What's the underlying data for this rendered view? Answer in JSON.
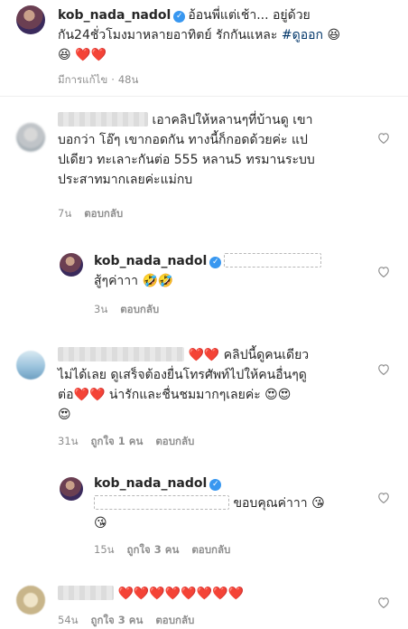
{
  "post": {
    "username": "kob_nada_nadol",
    "verified_icon": "verified-badge-icon",
    "caption_line1": "อ้อนพี่แต่เช้า... อยู่ด้วย",
    "caption_line2_a": "กัน24ชั่วโมงมาหลายอาทิตย์ รักกันแหละ",
    "hashtag": "#ดูออก",
    "emoji_grin": "😆",
    "emoji_heart": "❤️",
    "meta_edited": "มีการแก้ไข",
    "meta_dot": "·",
    "meta_time": "48น"
  },
  "comments": [
    {
      "line1": "เอาคลิปให้หลานๆที่บ้านดู เขา",
      "line2": "บอกว่า โอ๊ๆ เขากอดกัน ทางนี้ก็กอดด้วยค่ะ แป",
      "line3": "ปเดียว ทะเลาะกันต่อ 555 หลาน5 ทรมานระบบ",
      "line4": "ประสาทมากเลยค่ะแม่กบ",
      "time": "7น",
      "reply_label": "ตอบกลับ"
    },
    {
      "username": "kob_nada_nadol",
      "text": "สู้ๆค่าาา",
      "emoji": "🤣🤣",
      "time": "3น",
      "reply_label": "ตอบกลับ"
    },
    {
      "line1_text": "คลิปนี้ดูคนเดียว",
      "line2": "ไม่ได้เลย ดูเสร็จต้องยื่นโทรศัพท์ไปให้คนอื่นๆดู",
      "line3_a": "ต่อ",
      "line3_b": "น่ารักและชื่นชมมากๆเลยค่ะ",
      "emoji_eyes": "😍",
      "time": "31น",
      "likes": "ถูกใจ 1 คน",
      "reply_label": "ตอบกลับ"
    },
    {
      "username": "kob_nada_nadol",
      "text": "ขอบคุณค่าาา",
      "emoji_kiss": "😘",
      "time": "15น",
      "likes": "ถูกใจ 3 คน",
      "reply_label": "ตอบกลับ"
    },
    {
      "time": "54น",
      "likes": "ถูกใจ 3 คน",
      "reply_label": "ตอบกลับ"
    }
  ],
  "icons": {
    "like": "heart-outline-icon"
  },
  "colors": {
    "hashtag": "#003569",
    "verified": "#3897f0",
    "meta": "#8e8e8e",
    "heart": "#e0162b"
  }
}
